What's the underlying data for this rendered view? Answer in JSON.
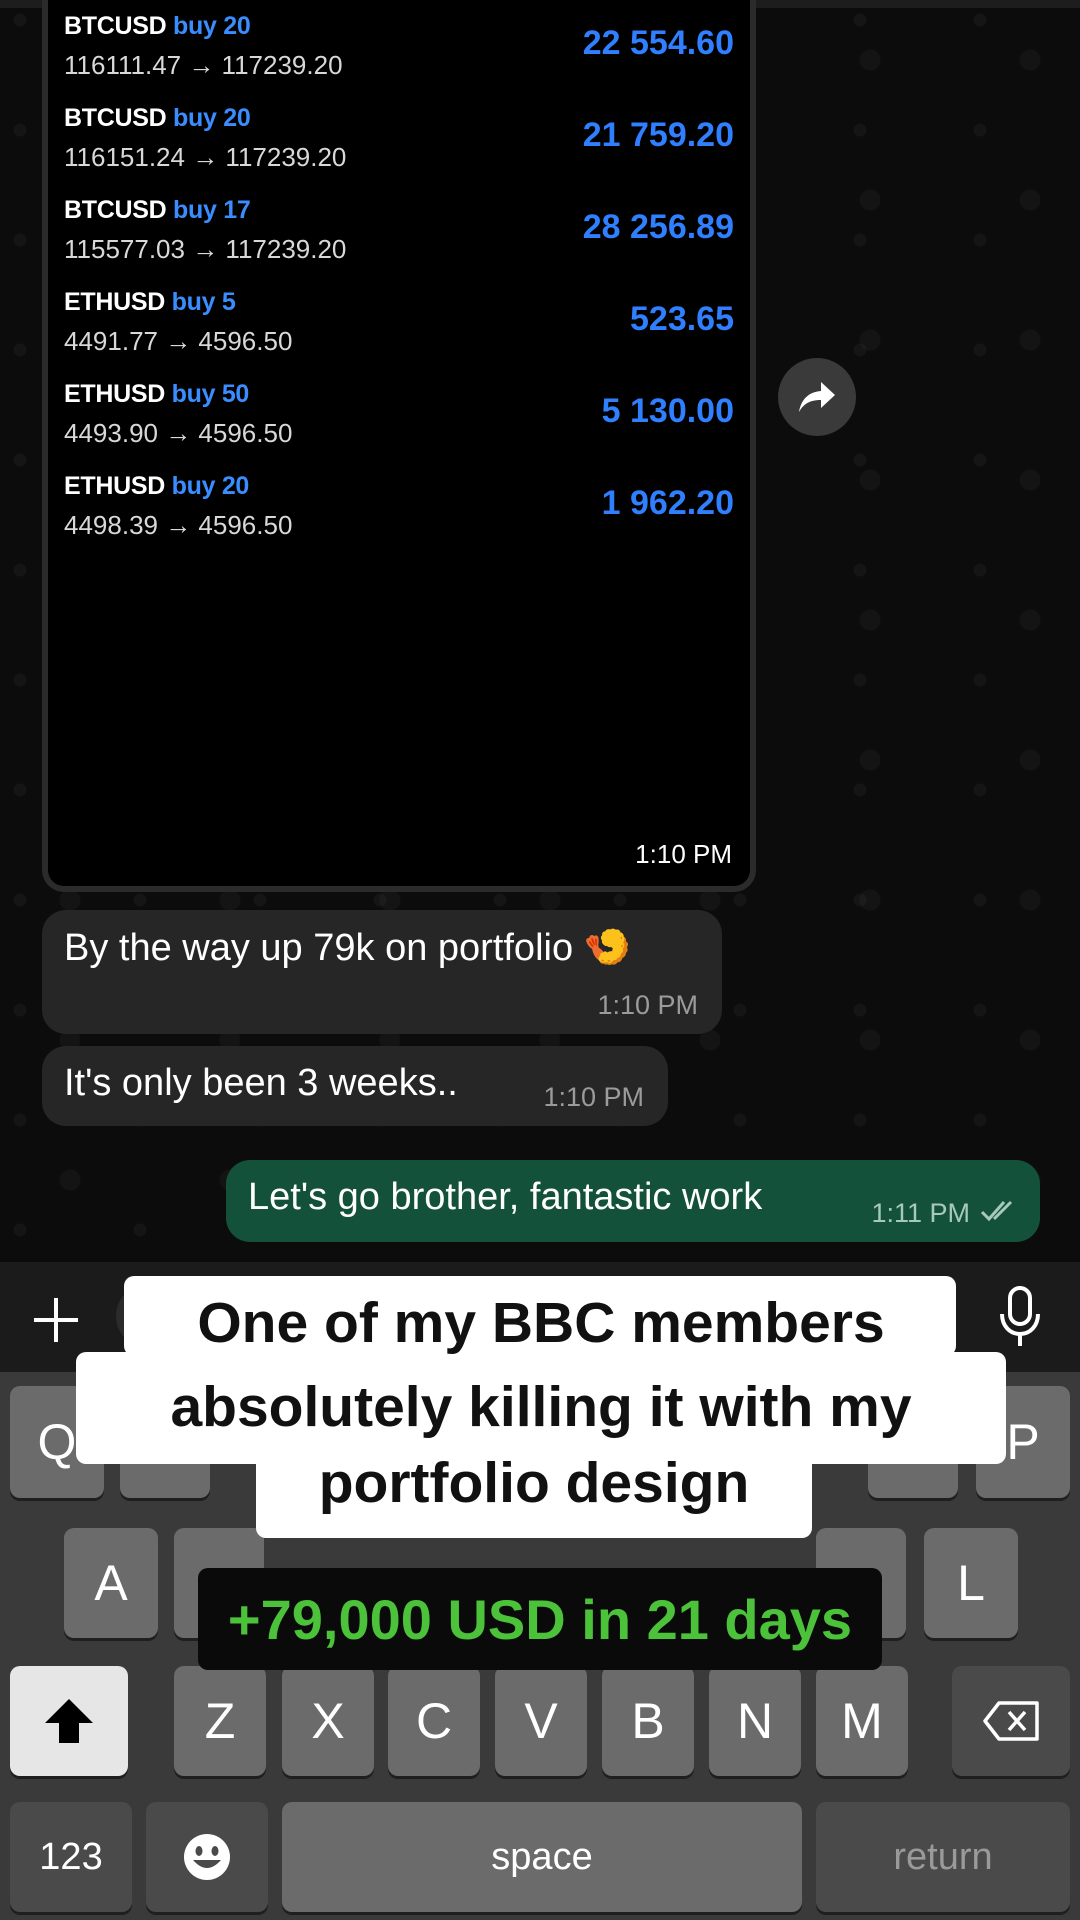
{
  "chat": {
    "trades": [
      {
        "symbol": "BTCUSD",
        "side": "buy 20",
        "prices": "116111.47 → 117239.20",
        "profit": "22 554.60"
      },
      {
        "symbol": "BTCUSD",
        "side": "buy 20",
        "prices": "116151.24 → 117239.20",
        "profit": "21 759.20"
      },
      {
        "symbol": "BTCUSD",
        "side": "buy 17",
        "prices": "115577.03 → 117239.20",
        "profit": "28 256.89"
      },
      {
        "symbol": "ETHUSD",
        "side": "buy 5",
        "prices": "4491.77 → 4596.50",
        "profit": "523.65"
      },
      {
        "symbol": "ETHUSD",
        "side": "buy 50",
        "prices": "4493.90 → 4596.50",
        "profit": "5 130.00"
      },
      {
        "symbol": "ETHUSD",
        "side": "buy 20",
        "prices": "4498.39 → 4596.50",
        "profit": "1 962.20"
      }
    ],
    "image_time": "1:10 PM",
    "messages": [
      {
        "text": "By the way up 79k on portfolio 🍤",
        "time": "1:10 PM"
      },
      {
        "text": "It's only been 3 weeks..",
        "time": "1:10 PM"
      },
      {
        "text": "Let's go brother, fantastic work",
        "time": "1:11 PM"
      }
    ]
  },
  "keyboard": {
    "row1_left": "Q",
    "row1_right": "P",
    "row2_left": "A",
    "row2_right": "L",
    "row3": [
      "Z",
      "X",
      "C",
      "V",
      "B",
      "N",
      "M"
    ],
    "numbers": "123",
    "space": "space",
    "return": "return"
  },
  "caption": {
    "line1": "One of my BBC members",
    "line2": "absolutely killing it with my",
    "line3": "portfolio design",
    "banner": "+79,000 USD in 21 days"
  },
  "colors": {
    "profit": "#2f7fff",
    "outgoing": "#14513a",
    "banner_text": "#4bc23a"
  },
  "icons": [
    "forward-icon",
    "plus-icon",
    "mic-icon",
    "shift-icon",
    "backspace-icon",
    "emoji-icon",
    "read-receipt-icon"
  ]
}
